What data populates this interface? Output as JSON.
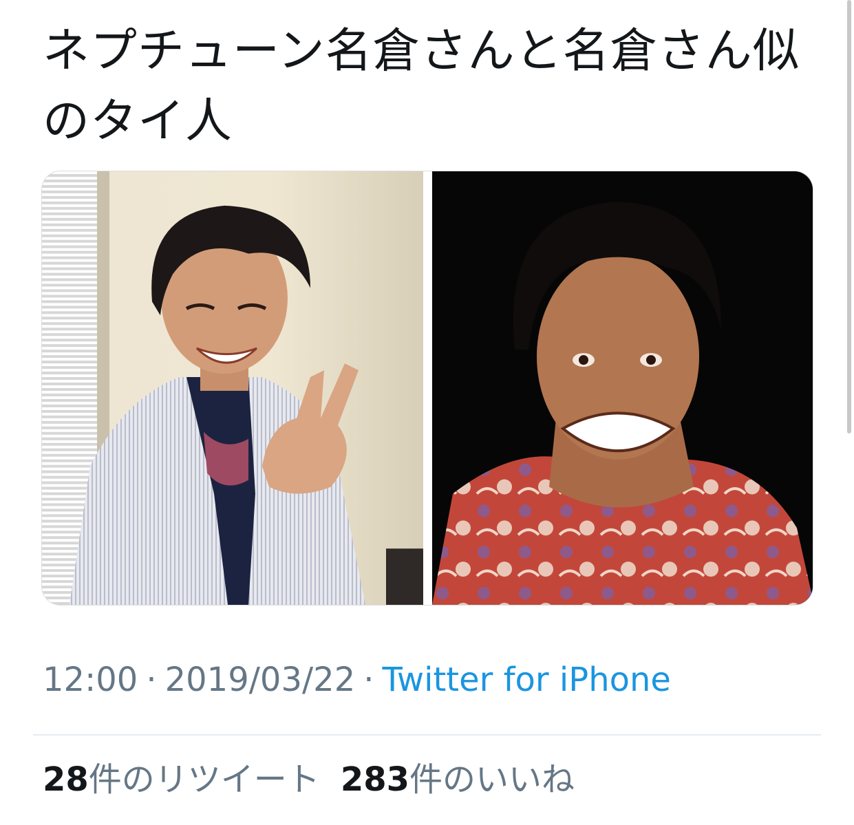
{
  "tweet": {
    "text": "ネプチューン名倉さんと名倉さん似のタイ人",
    "time": "12:00",
    "date": "2019/03/22",
    "separator": "·",
    "source": "Twitter for iPhone",
    "retweet_count": "28",
    "retweet_label": "件のリツイート",
    "like_count": "283",
    "like_label": "件のいいね"
  },
  "colors": {
    "text_primary": "#14171a",
    "text_secondary": "#657786",
    "link": "#1b95e0",
    "divider": "#e6ecf0"
  }
}
